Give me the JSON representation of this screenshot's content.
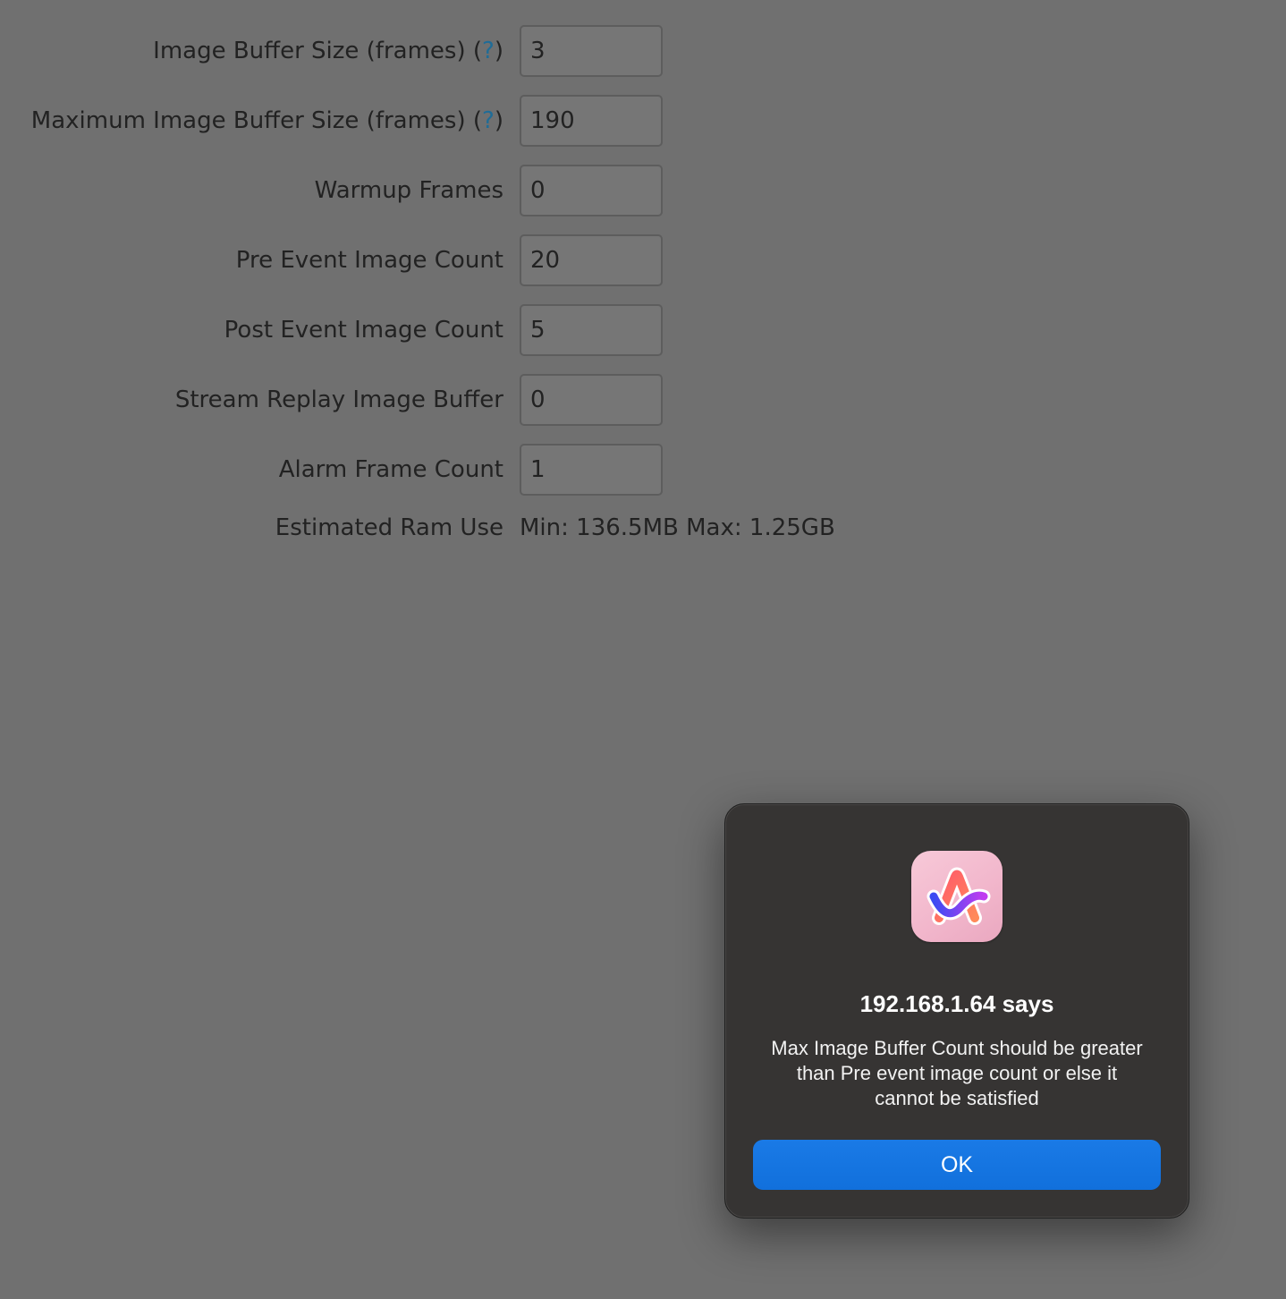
{
  "form": {
    "fields": [
      {
        "label": "Image Buffer Size (frames)",
        "help": "?",
        "value": "3"
      },
      {
        "label": "Maximum Image Buffer Size (frames)",
        "help": "?",
        "value": "190"
      },
      {
        "label": "Warmup Frames",
        "value": "0"
      },
      {
        "label": "Pre Event Image Count",
        "value": "20"
      },
      {
        "label": "Post Event Image Count",
        "value": "5"
      },
      {
        "label": "Stream Replay Image Buffer",
        "value": "0"
      },
      {
        "label": "Alarm Frame Count",
        "value": "1"
      }
    ],
    "ram": {
      "label": "Estimated Ram Use",
      "value": "Min: 136.5MB Max: 1.25GB"
    }
  },
  "dialog": {
    "icon": "arc-browser-icon",
    "title": "192.168.1.64 says",
    "message": "Max Image Buffer Count should be greater than Pre event image count or else it cannot be satisfied",
    "ok_label": "OK"
  },
  "colors": {
    "background": "#707070",
    "dialog_background": "#363433",
    "button_blue": "#1673e0",
    "help_link": "#1f6c97"
  }
}
